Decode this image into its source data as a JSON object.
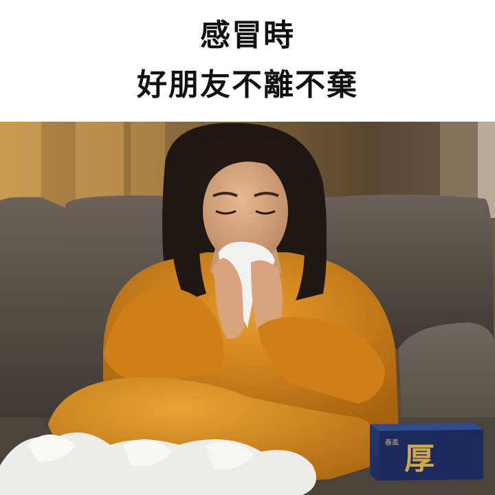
{
  "caption": {
    "line1": "感冒時",
    "line2": "好朋友不離不棄"
  },
  "product": {
    "box_glyph": "厚",
    "box_brand": "春風",
    "box_color": "#1c2a5a",
    "glyph_color": "#d3a64b"
  },
  "colors": {
    "sweater": "#d98a1c",
    "sofa": "#5f5850",
    "wall": "#8a6a3c"
  }
}
